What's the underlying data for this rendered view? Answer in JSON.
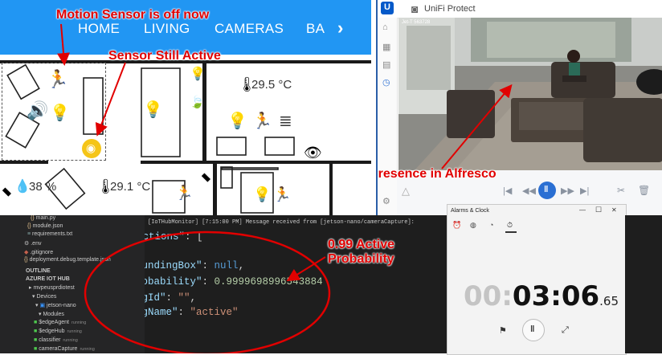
{
  "annotations": {
    "motion_off": "Motion Sensor is off now",
    "sensor_active": "Sensor Still Active",
    "presence": "Presence in Alfresco",
    "active_prob_line1": "0.99 Active",
    "active_prob_line2": "Probability",
    "color": "#e10000"
  },
  "home": {
    "nav": [
      "HOME",
      "LIVING",
      "CAMERAS",
      "BA",
      "›"
    ],
    "temps": [
      "29.5 °C",
      "38 %",
      "29.1 °C"
    ],
    "accent": "#2196f3"
  },
  "unifi": {
    "brand": "UniFi Protect",
    "timestamp": "Jet-T 563728"
  },
  "vscode": {
    "files": [
      {
        "icon": "{}",
        "label": "main.py"
      },
      {
        "icon": "{}",
        "label": "module.json"
      },
      {
        "icon": "≡",
        "label": "requirements.txt"
      },
      {
        "icon": "⚙",
        "label": ".env"
      },
      {
        "icon": "◆",
        "label": ".gitignore"
      },
      {
        "icon": "{}",
        "label": "deployment.debug.template.json"
      }
    ],
    "outline_label": "OUTLINE",
    "iot_hub_label": "AZURE IOT HUB",
    "hub_name": "mvpeusprdiotest",
    "devices_label": "Devices",
    "device_name": "jetson-nano",
    "modules_label": "Modules",
    "modules": [
      {
        "name": "$edgeAgent",
        "status": "running"
      },
      {
        "name": "$edgeHub",
        "status": "running"
      },
      {
        "name": "classifier",
        "status": "running"
      },
      {
        "name": "cameraCapture",
        "status": "running"
      }
    ],
    "log_header": "[IoTHubMonitor] [7:15:00 PM] Message received from [jetson-nano/cameraCapture]:",
    "code": {
      "detections_key": "\"detections\"",
      "bbox_key": "\"boundingBox\"",
      "bbox_val": "null",
      "prob_key": "\"probability\"",
      "prob_val": "0.9999698996543884",
      "tagid_key": "\"tagId\"",
      "tagid_val": "\"\"",
      "tagname_key": "\"tagName\"",
      "tagname_val": "\"active\""
    }
  },
  "clock": {
    "title": "Alarms & Clock",
    "time_dim": "00:",
    "time_main": "03:06",
    "time_frac": ".65",
    "win_min": "—",
    "win_max": "☐",
    "win_close": "✕"
  }
}
